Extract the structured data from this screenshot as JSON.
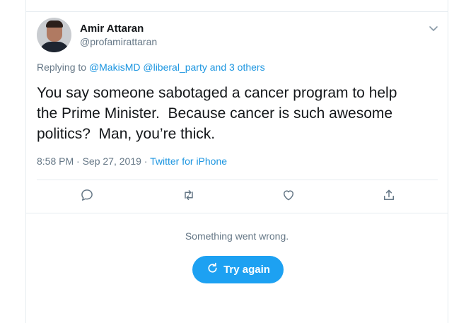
{
  "tweet": {
    "author_name": "Amir Attaran",
    "author_handle": "@profamirattaran",
    "replying_to": {
      "prefix": "Replying to",
      "mentions": [
        "@MakisMD",
        "@liberal_party"
      ],
      "others": "and 3 others"
    },
    "text_lines": [
      "You say someone sabotaged a cancer program to help",
      "the Prime Minister.  Because cancer is such awesome",
      "politics?  Man, you’re thick."
    ],
    "time": "8:58 PM",
    "date": "Sep 27, 2019",
    "source": "Twitter for iPhone",
    "separator": "·"
  },
  "actions": {
    "icons": [
      "reply-icon",
      "retweet-icon",
      "like-icon",
      "share-icon"
    ]
  },
  "error": {
    "message": "Something went wrong.",
    "retry_label": "Try again"
  },
  "colors": {
    "accent": "#1da1f2",
    "link": "#1b95e0",
    "secondary_text": "#657786",
    "border": "#e6ecf0"
  }
}
